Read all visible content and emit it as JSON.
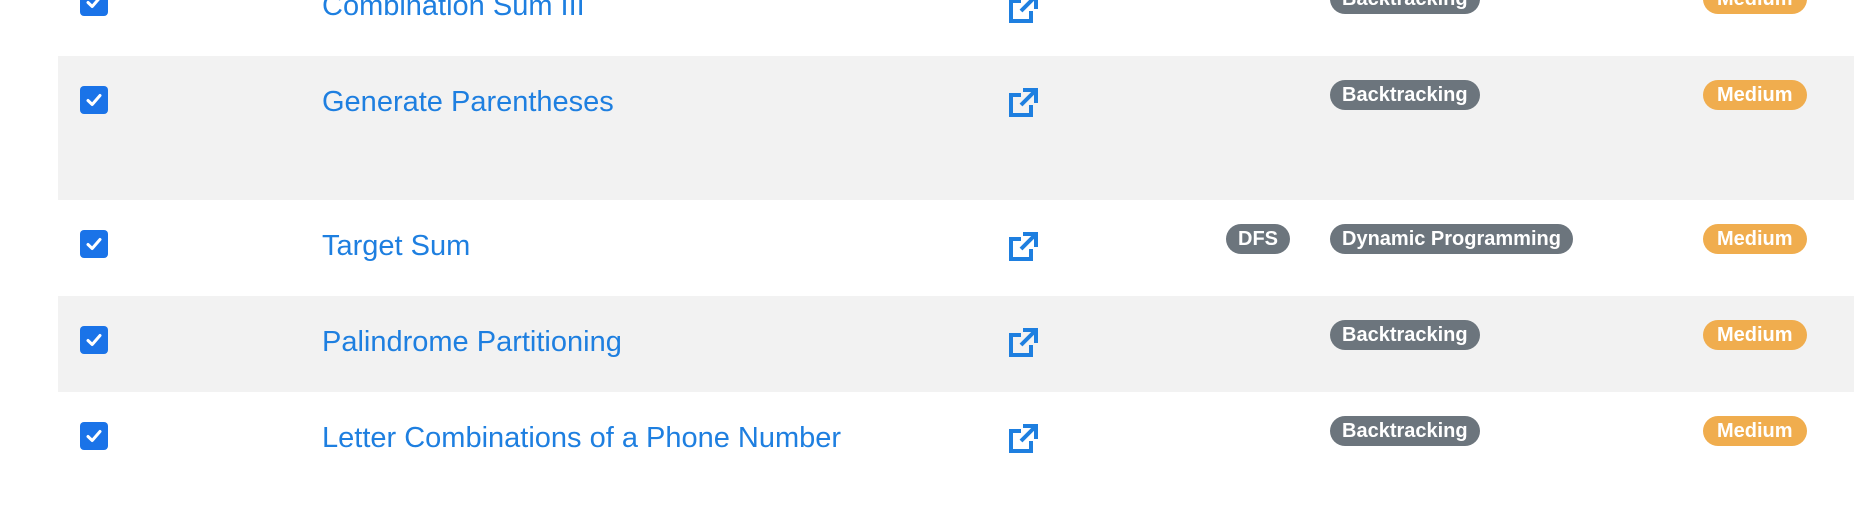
{
  "colors": {
    "checkbox": "#1a73e8",
    "link": "#1e7fe0",
    "tag_badge": "#6c757d",
    "difficulty_medium": "#f0ad4e",
    "row_shaded": "#f2f2f2"
  },
  "rows": [
    {
      "title": "Combination Sum III",
      "checked": true,
      "tags": [
        "Backtracking"
      ],
      "difficulty": "Medium",
      "icon": "external-link-icon"
    },
    {
      "title": "Generate Parentheses",
      "checked": true,
      "tags": [
        "Backtracking"
      ],
      "difficulty": "Medium",
      "icon": "external-link-icon"
    },
    {
      "title": "Target Sum",
      "checked": true,
      "tags": [
        "DFS",
        "Dynamic Programming"
      ],
      "difficulty": "Medium",
      "icon": "external-link-icon"
    },
    {
      "title": "Palindrome Partitioning",
      "checked": true,
      "tags": [
        "Backtracking"
      ],
      "difficulty": "Medium",
      "icon": "external-link-icon"
    },
    {
      "title": "Letter Combinations of a Phone Number",
      "checked": true,
      "tags": [
        "Backtracking"
      ],
      "difficulty": "Medium",
      "icon": "external-link-icon"
    }
  ]
}
